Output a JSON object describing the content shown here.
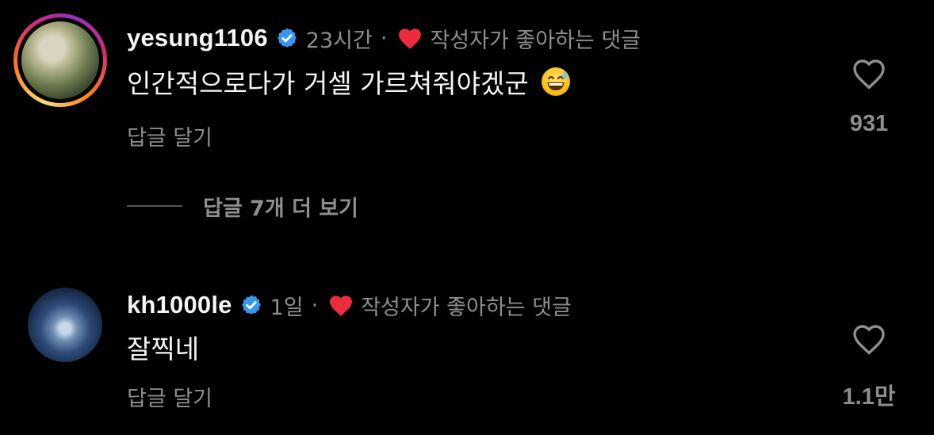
{
  "colors": {
    "background": "#000000",
    "primary_text": "#f5f5f5",
    "secondary_text": "#8e8e8e",
    "verified_blue": "#3797f0",
    "liked_heart_red": "#ed2c3b"
  },
  "comments": [
    {
      "username": "yesung1106",
      "verified": true,
      "time": "23시간",
      "separator": "·",
      "liked_by_author_label": "작성자가 좋아하는 댓글",
      "text": "인간적으로다가 거셀 가르쳐줘야겠군",
      "emoji": "grinning-face-with-sweat",
      "reply_label": "답글 달기",
      "like_count": "931",
      "avatar_has_story_ring": true
    },
    {
      "username": "kh1000le",
      "verified": true,
      "time": "1일",
      "separator": "·",
      "liked_by_author_label": "작성자가 좋아하는 댓글",
      "text": "잘찍네",
      "reply_label": "답글 달기",
      "like_count": "1.1만",
      "avatar_has_story_ring": false
    }
  ],
  "view_replies_label": "답글 7개 더 보기",
  "icons": {
    "verified": "verified-badge-icon",
    "liked_by_author": "heart-filled-icon",
    "like": "heart-outline-icon"
  }
}
